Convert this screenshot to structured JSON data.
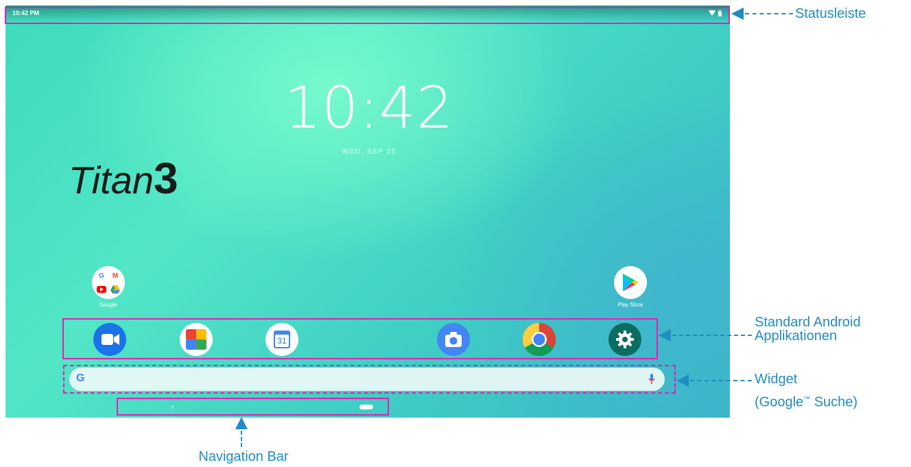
{
  "status_bar": {
    "time": "10:42 PM",
    "icons": [
      "wifi-icon",
      "battery-icon"
    ]
  },
  "clock": {
    "time": "10:42",
    "date": "WED, SEP 25"
  },
  "wallpaper": {
    "brand_text": "Titan",
    "brand_number": "3"
  },
  "apps": {
    "google_folder": "Google",
    "play_store": "Play Store"
  },
  "dock": {
    "icons": [
      "duo-icon",
      "photos-icon",
      "calendar-icon",
      "camera-icon",
      "chrome-icon",
      "settings-icon"
    ],
    "calendar_day": "31"
  },
  "search_widget": {
    "g_logo": "G",
    "icon": "mic-icon"
  },
  "navigation": {
    "back": "‹"
  },
  "annotations": {
    "status_bar": "Statusleiste",
    "standard_apps_line1": "Standard Android",
    "standard_apps_line2": "Applikationen",
    "widget_line1": "Widget",
    "widget_line2a": "(Google",
    "widget_tm": "™",
    "widget_line2b": " Suche)",
    "nav_bar": "Navigation Bar"
  },
  "colors": {
    "highlight": "#e020b0",
    "callout": "#1f8cc3",
    "settings": "#0b6d62"
  }
}
